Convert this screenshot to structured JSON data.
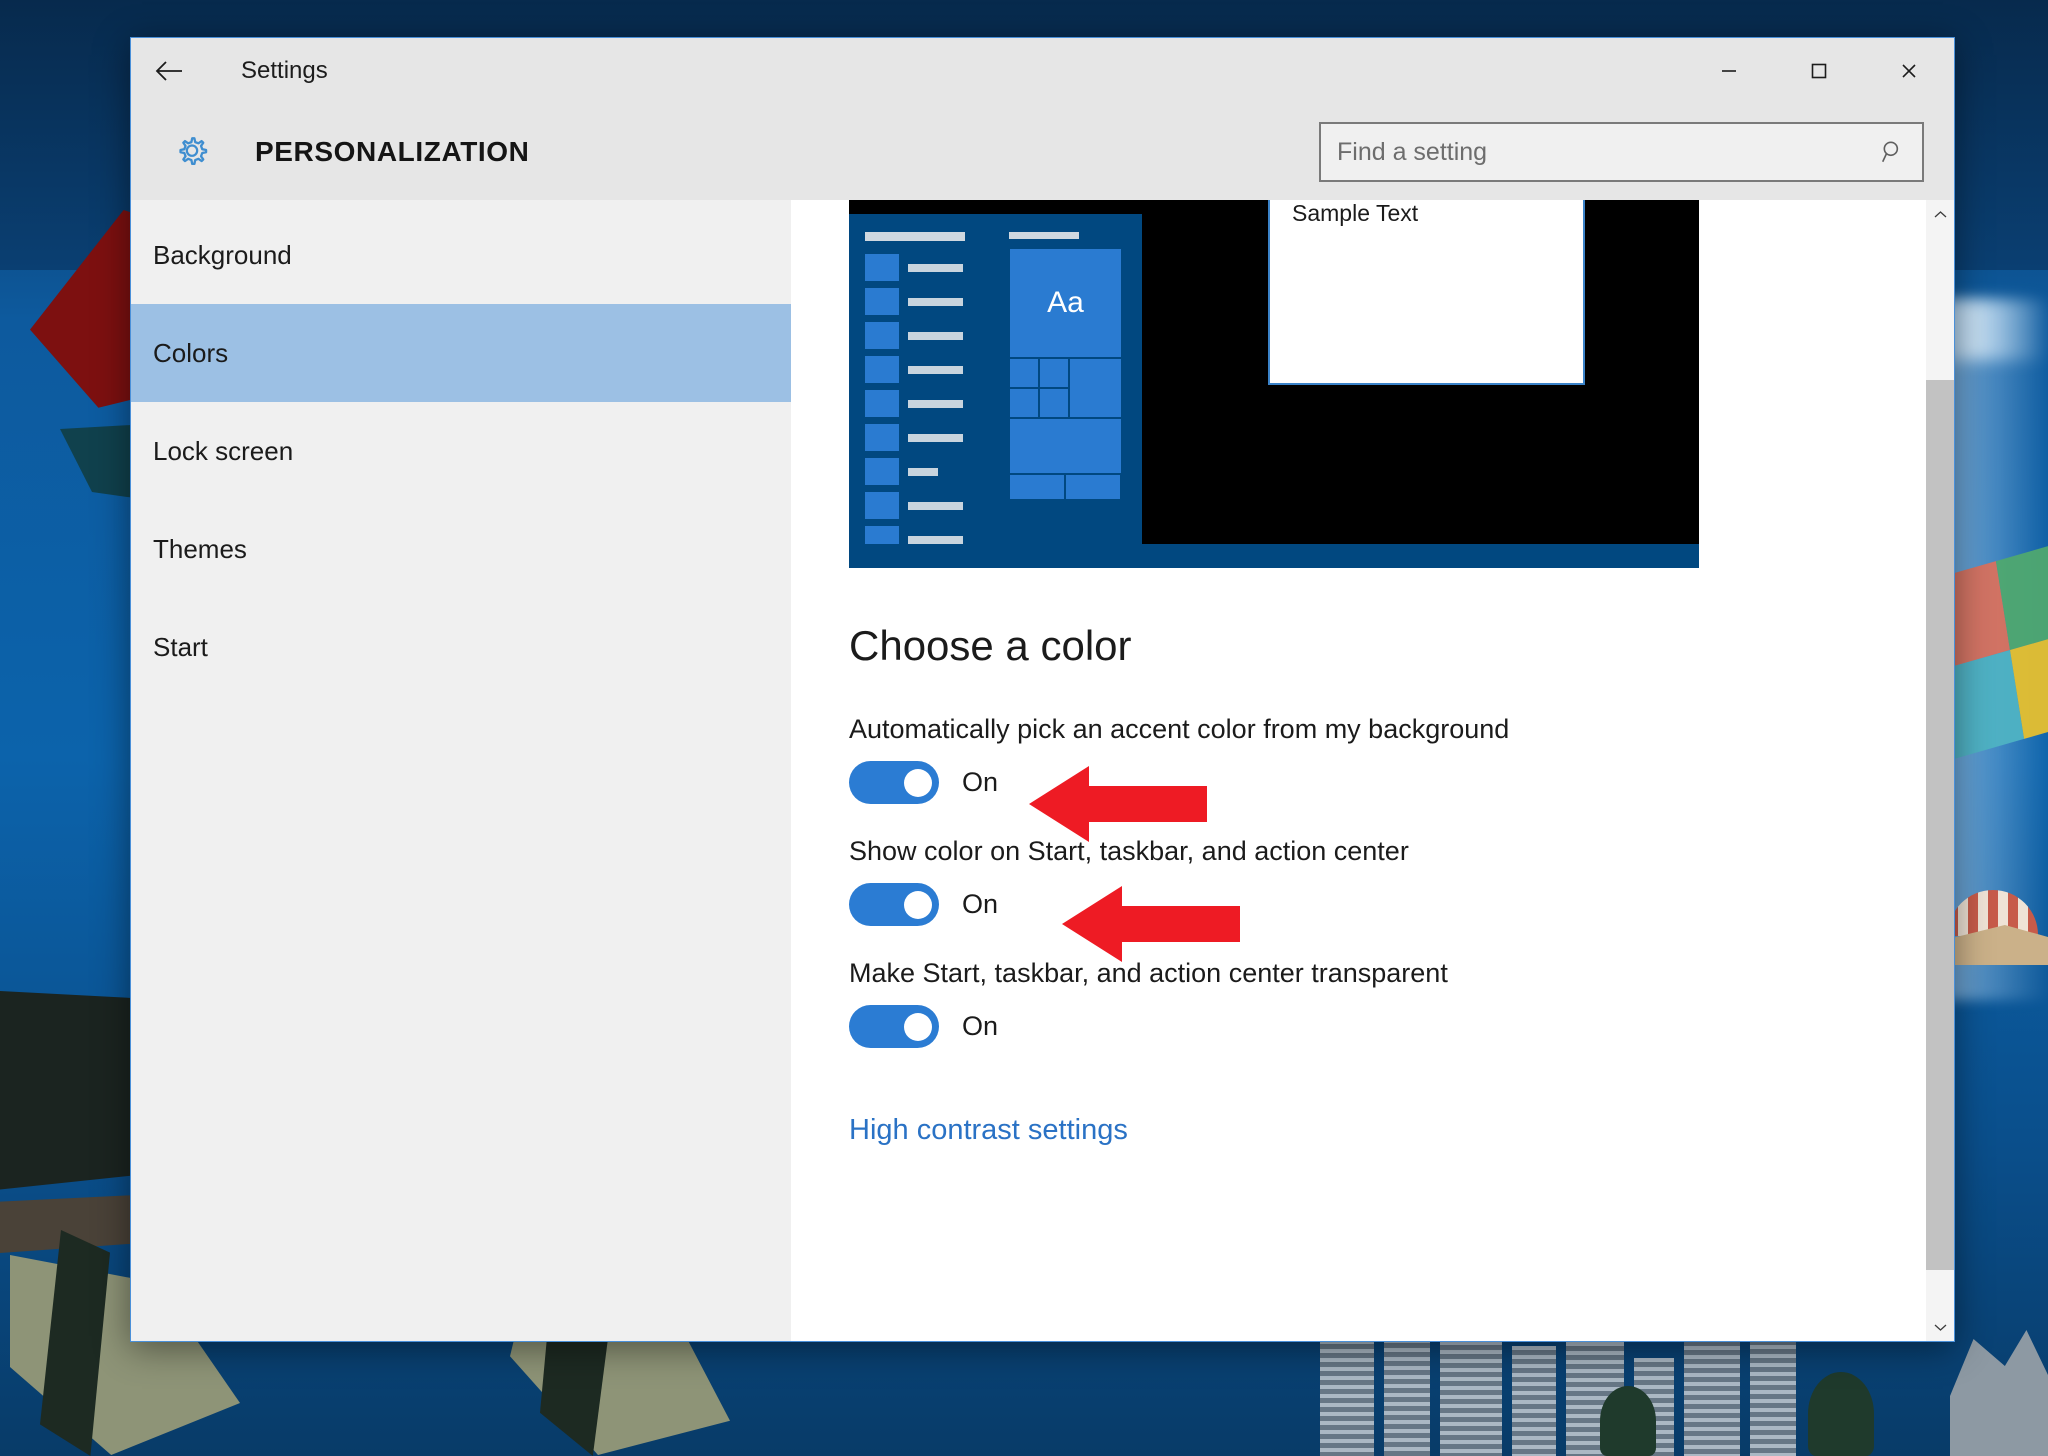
{
  "window": {
    "title": "Settings",
    "app_title": "PERSONALIZATION",
    "back_icon": "back-arrow-icon",
    "gear_icon": "gear-icon",
    "controls": {
      "minimize": "minimize-icon",
      "maximize": "maximize-icon",
      "close": "close-icon"
    }
  },
  "search": {
    "placeholder": "Find a setting",
    "value": "",
    "icon": "search-icon"
  },
  "sidebar": {
    "items": [
      {
        "label": "Background",
        "selected": false
      },
      {
        "label": "Colors",
        "selected": true
      },
      {
        "label": "Lock screen",
        "selected": false
      },
      {
        "label": "Themes",
        "selected": false
      },
      {
        "label": "Start",
        "selected": false
      }
    ]
  },
  "preview": {
    "tile_letter": "Aa",
    "window_text": "Sample Text",
    "accent_color": "#2a7bd1",
    "start_color": "#014880",
    "desktop_color": "#000000"
  },
  "main": {
    "section_title": "Choose a color",
    "settings": [
      {
        "label": "Automatically pick an accent color from my background",
        "state": "On",
        "has_arrow": true
      },
      {
        "label": "Show color on Start, taskbar, and action center",
        "state": "On",
        "has_arrow": true
      },
      {
        "label": "Make Start, taskbar, and action center transparent",
        "state": "On",
        "has_arrow": false
      }
    ],
    "link": "High contrast settings"
  },
  "colors": {
    "accent": "#2b7cd3",
    "link": "#2a72c5",
    "selection": "#9cc0e4",
    "callout_red": "#ee1b24",
    "chrome": "#e6e6e6",
    "sidebar": "#f0f0f0"
  },
  "scrollbar": {
    "up_icon": "chevron-up-icon",
    "down_icon": "chevron-down-icon"
  }
}
